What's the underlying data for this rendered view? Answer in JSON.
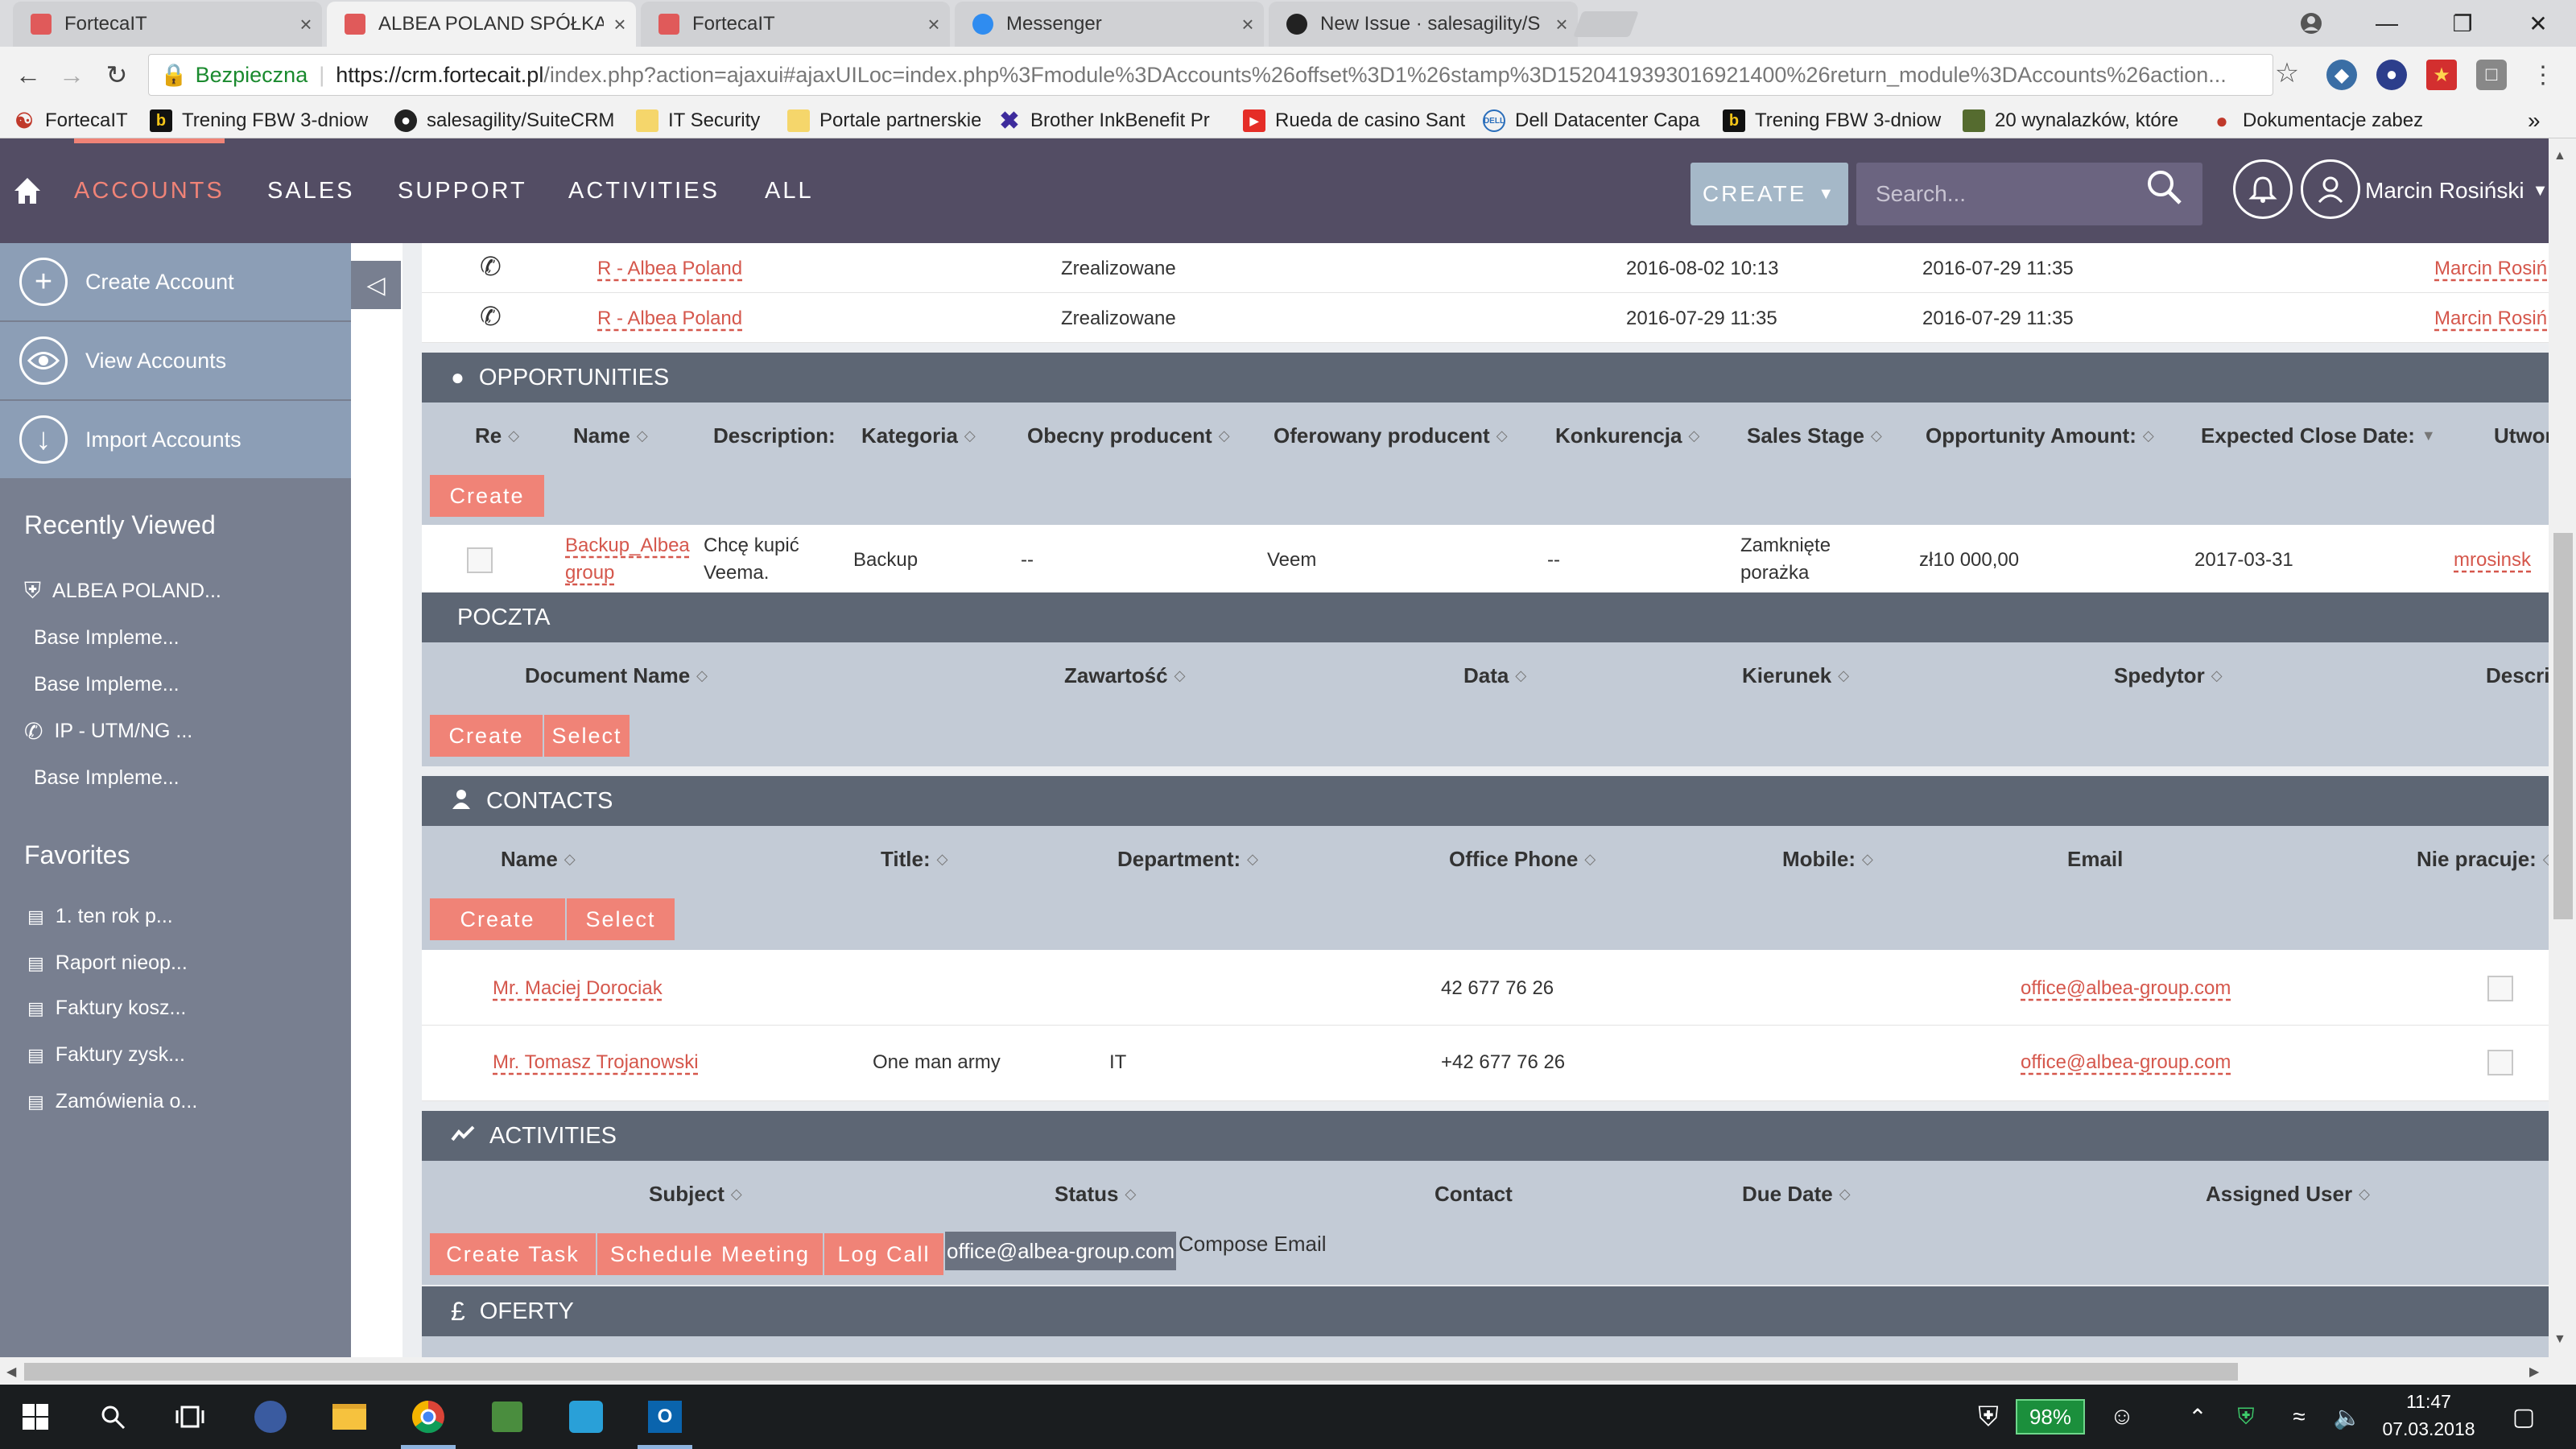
{
  "browser": {
    "tabs": [
      {
        "title": "FortecaIT",
        "close": "×"
      },
      {
        "title": "ALBEA POLAND SPÓŁKA",
        "close": "×"
      },
      {
        "title": "FortecaIT",
        "close": "×"
      },
      {
        "title": "Messenger",
        "close": "×"
      },
      {
        "title": "New Issue · salesagility/S",
        "close": "×"
      }
    ],
    "security_label": "Bezpieczna",
    "url_host": "https://crm.fortecait.pl",
    "url_path": "/index.php?action=ajaxui#ajaxUILoc=index.php%3Fmodule%3DAccounts%26offset%3D1%26stamp%3D1520419393016921400%26return_module%3DAccounts%26action...",
    "bookmarks": [
      "FortecaIT",
      "Trening FBW 3-dniow",
      "salesagility/SuiteCRM",
      "IT Security",
      "Portale partnerskie",
      "Brother InkBenefit Pr",
      "Rueda de casino Sant",
      "Dell Datacenter Capa",
      "Trening FBW 3-dniow",
      "20 wynalazków, które",
      "Dokumentacje zabez"
    ],
    "more_bookmarks": "»"
  },
  "crm_nav": {
    "items": [
      "ACCOUNTS",
      "SALES",
      "SUPPORT",
      "ACTIVITIES",
      "ALL"
    ],
    "create_label": "CREATE",
    "search_placeholder": "Search...",
    "user_name": "Marcin Rosiński"
  },
  "sidebar": {
    "actions": [
      "Create Account",
      "View Accounts",
      "Import Accounts"
    ],
    "recently_viewed_title": "Recently Viewed",
    "recently_viewed": [
      "ALBEA POLAND...",
      "Base Impleme...",
      "Base Impleme...",
      "IP - UTM/NG ...",
      "Base Impleme..."
    ],
    "favorites_title": "Favorites",
    "favorites": [
      "1. ten rok p...",
      "Raport nieop...",
      "Faktury kosz...",
      "Faktury zysk...",
      "Zamówienia o..."
    ]
  },
  "history_rows": [
    {
      "related": "R - Albea Poland",
      "status": "Zrealizowane",
      "date1": "2016-08-02 10:13",
      "date2": "2016-07-29 11:35",
      "user": "Marcin Rosiń"
    },
    {
      "related": "R - Albea Poland",
      "status": "Zrealizowane",
      "date1": "2016-07-29 11:35",
      "date2": "2016-07-29 11:35",
      "user": "Marcin Rosiń"
    }
  ],
  "opportunities": {
    "title": "OPPORTUNITIES",
    "columns": [
      "Re",
      "Name",
      "Description:",
      "Kategoria",
      "Obecny producent",
      "Oferowany producent",
      "Konkurencja",
      "Sales Stage",
      "Opportunity Amount:",
      "Expected Close Date:",
      "Utworz"
    ],
    "create_label": "Create",
    "rows": [
      {
        "name_l1": "Backup_Albea",
        "name_l2": "group",
        "desc_l1": "Chcę kupić",
        "desc_l2": "Veema.",
        "kategoria": "Backup",
        "obecny": "--",
        "oferowany": "Veem",
        "konkurencja": "--",
        "stage_l1": "Zamknięte",
        "stage_l2": "porażka",
        "amount": "zł10 000,00",
        "close_date": "2017-03-31",
        "created_by": "mrosinsk"
      }
    ]
  },
  "poczta": {
    "title": "POCZTA",
    "columns": [
      "Document Name",
      "Zawartość",
      "Data",
      "Kierunek",
      "Spedytor",
      "Descri"
    ],
    "create_label": "Create",
    "select_label": "Select"
  },
  "contacts": {
    "title": "CONTACTS",
    "columns": [
      "Name",
      "Title:",
      "Department:",
      "Office Phone",
      "Mobile:",
      "Email",
      "Nie pracuje:"
    ],
    "create_label": "Create",
    "select_label": "Select",
    "rows": [
      {
        "name": "Mr. Maciej Dorociak",
        "title": "",
        "department": "",
        "phone": "42 677 76 26",
        "email": "office@albea-group.com"
      },
      {
        "name": "Mr. Tomasz Trojanowski",
        "title": "One man army",
        "department": "IT",
        "phone": "+42 677 76 26",
        "email": "office@albea-group.com"
      }
    ]
  },
  "activities": {
    "title": "ACTIVITIES",
    "columns": [
      "Subject",
      "Status",
      "Contact",
      "Due Date",
      "Assigned User"
    ],
    "buttons": [
      "Create Task",
      "Schedule Meeting",
      "Log Call"
    ],
    "email_chip": "office@albea-group.com",
    "compose_email": "Compose Email"
  },
  "oferty": {
    "title": "OFERTY"
  },
  "taskbar": {
    "battery": "98%",
    "time": "11:47",
    "date": "07.03.2018"
  },
  "colors": {
    "nav_bg": "#534d64",
    "accent": "#f08377",
    "sidebar_bg": "#787f90",
    "sidebar_action_bg": "#8c9eb6",
    "panel_header": "#5d6674",
    "column_header": "#c3cbd6"
  }
}
